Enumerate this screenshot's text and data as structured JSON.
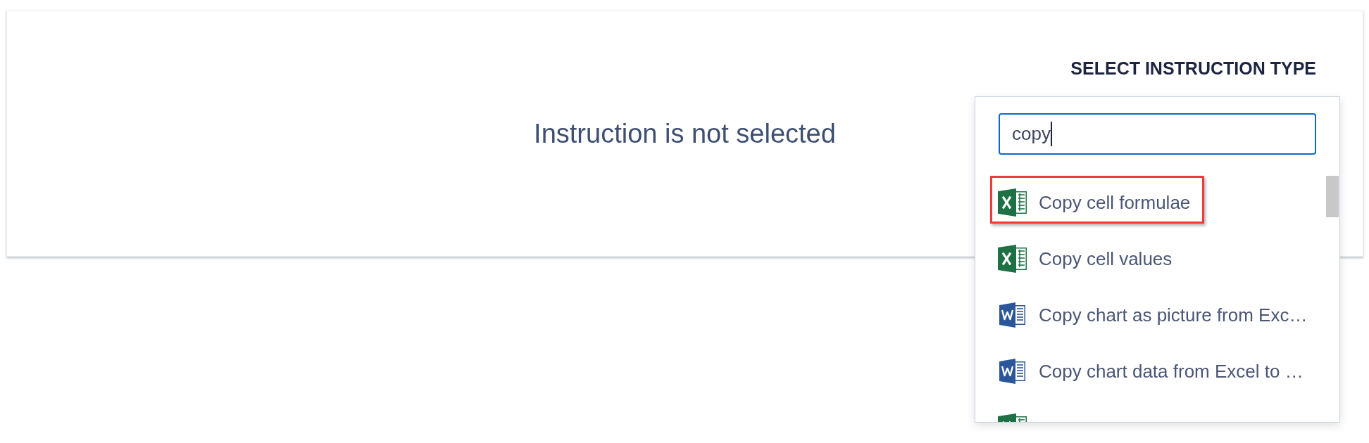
{
  "card": {
    "message": "Instruction is not selected"
  },
  "instruction_type": {
    "title": "SELECT INSTRUCTION TYPE",
    "search": {
      "value": "copy",
      "focused": true
    },
    "options": [
      {
        "kind": "spreadsheet",
        "label": "Copy cell formulae",
        "selected": true
      },
      {
        "kind": "spreadsheet",
        "label": "Copy cell values",
        "selected": false
      },
      {
        "kind": "document",
        "label": "Copy chart as picture from Exc…",
        "selected": false
      },
      {
        "kind": "document",
        "label": "Copy chart data from Excel to …",
        "selected": false
      },
      {
        "kind": "spreadsheet",
        "selected": false
      }
    ]
  }
}
